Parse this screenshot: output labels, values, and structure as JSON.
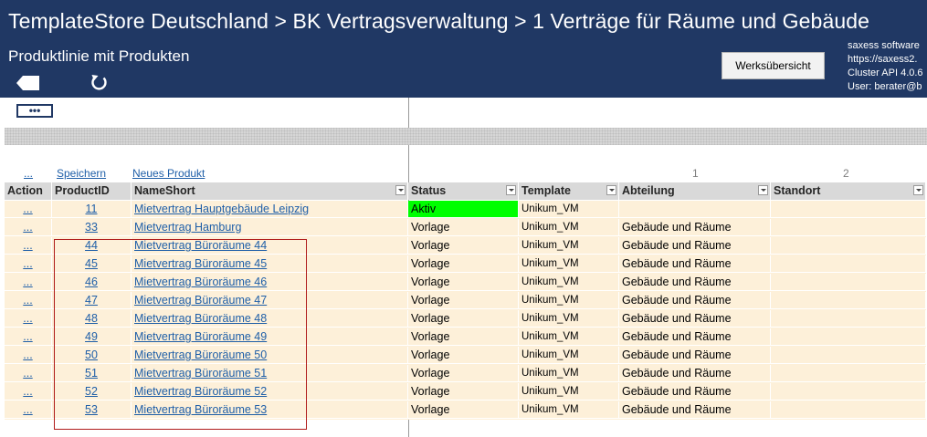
{
  "header": {
    "title": "TemplateStore Deutschland > BK  Vertragsverwaltung > 1  Verträge für Räume und Gebäude",
    "subtitle": "Produktlinie mit Produkten",
    "werks_button": "Werksübersicht",
    "info_lines": [
      "saxess software",
      "https://saxess2.",
      "Cluster API 4.0.6",
      "User: berater@b"
    ]
  },
  "toolbar": {
    "more_button": "•••"
  },
  "controls": {
    "dots": "...",
    "save": "Speichern",
    "new_product": "Neues Produkt"
  },
  "column_numbers": [
    "1",
    "2"
  ],
  "columns": [
    "Action",
    "ProductID",
    "NameShort",
    "Status",
    "Template",
    "Abteilung",
    "Standort"
  ],
  "rows": [
    {
      "action": "...",
      "id": "11",
      "name": "Mietvertrag Hauptgebäude Leipzig",
      "status": "Aktiv",
      "template": "Unikum_VM",
      "abteilung": "",
      "standort": ""
    },
    {
      "action": "...",
      "id": "33",
      "name": "Mietvertrag Hamburg",
      "status": "Vorlage",
      "template": "Unikum_VM",
      "abteilung": "Gebäude und Räume",
      "standort": ""
    },
    {
      "action": "...",
      "id": "44",
      "name": "Mietvertrag Büroräume 44",
      "status": "Vorlage",
      "template": "Unikum_VM",
      "abteilung": "Gebäude und Räume",
      "standort": ""
    },
    {
      "action": "...",
      "id": "45",
      "name": "Mietvertrag Büroräume 45",
      "status": "Vorlage",
      "template": "Unikum_VM",
      "abteilung": "Gebäude und Räume",
      "standort": ""
    },
    {
      "action": "...",
      "id": "46",
      "name": "Mietvertrag Büroräume 46",
      "status": "Vorlage",
      "template": "Unikum_VM",
      "abteilung": "Gebäude und Räume",
      "standort": ""
    },
    {
      "action": "...",
      "id": "47",
      "name": "Mietvertrag Büroräume 47",
      "status": "Vorlage",
      "template": "Unikum_VM",
      "abteilung": "Gebäude und Räume",
      "standort": ""
    },
    {
      "action": "...",
      "id": "48",
      "name": "Mietvertrag Büroräume 48",
      "status": "Vorlage",
      "template": "Unikum_VM",
      "abteilung": "Gebäude und Räume",
      "standort": ""
    },
    {
      "action": "...",
      "id": "49",
      "name": "Mietvertrag Büroräume 49",
      "status": "Vorlage",
      "template": "Unikum_VM",
      "abteilung": "Gebäude und Räume",
      "standort": ""
    },
    {
      "action": "...",
      "id": "50",
      "name": "Mietvertrag Büroräume 50",
      "status": "Vorlage",
      "template": "Unikum_VM",
      "abteilung": "Gebäude und Räume",
      "standort": ""
    },
    {
      "action": "...",
      "id": "51",
      "name": "Mietvertrag Büroräume 51",
      "status": "Vorlage",
      "template": "Unikum_VM",
      "abteilung": "Gebäude und Räume",
      "standort": ""
    },
    {
      "action": "...",
      "id": "52",
      "name": "Mietvertrag Büroräume 52",
      "status": "Vorlage",
      "template": "Unikum_VM",
      "abteilung": "Gebäude und Räume",
      "standort": ""
    },
    {
      "action": "...",
      "id": "53",
      "name": "Mietvertrag Büroräume 53",
      "status": "Vorlage",
      "template": "Unikum_VM",
      "abteilung": "Gebäude und Räume",
      "standort": ""
    }
  ],
  "colors": {
    "header_bg": "#203864",
    "row_bg": "#fdf0d9",
    "aktiv_bg": "#00ff00",
    "highlight_border": "#b01c1c",
    "link": "#1f5fa8"
  },
  "icons": {
    "back": "back-arrow-icon",
    "refresh": "refresh-icon",
    "filter": "filter-dropdown-icon"
  }
}
